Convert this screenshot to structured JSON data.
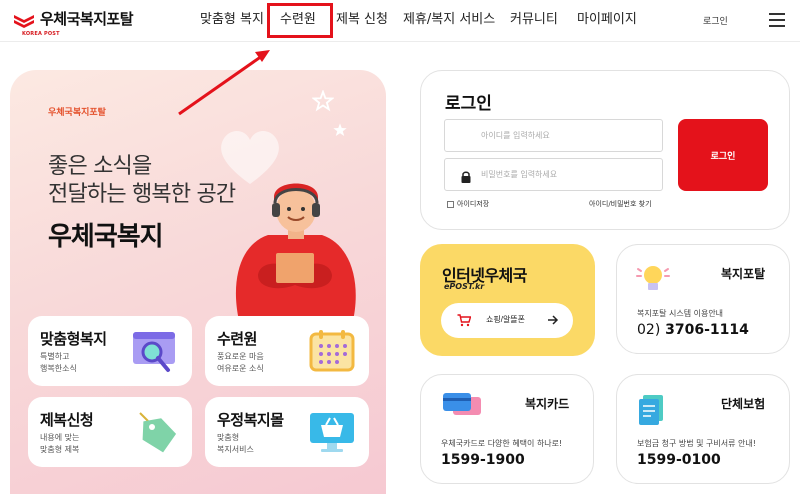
{
  "header": {
    "logo_title": "우체국복지포탈",
    "logo_sub": "KOREA POST",
    "nav": [
      "맞춤형 복지",
      "수련원",
      "제복 신청",
      "제휴/복지 서비스",
      "커뮤니티",
      "마이페이지"
    ],
    "login_link": "로그인"
  },
  "hero": {
    "tag": "우체국복지포탈",
    "line1": "좋은 소식을",
    "line2": "전달하는 행복한 공간",
    "strong": "우체국복지",
    "tiles": [
      {
        "title": "맞춤형복지",
        "desc1": "특별하고",
        "desc2": "행복한소식"
      },
      {
        "title": "수련원",
        "desc1": "풍요로운 마음",
        "desc2": "여유로운 소식"
      },
      {
        "title": "제복신청",
        "desc1": "내용에 맞는",
        "desc2": "맞춤형 제복"
      },
      {
        "title": "우정복지몰",
        "desc1": "맞춤형",
        "desc2": "복지서비스"
      }
    ]
  },
  "login": {
    "title": "로그인",
    "id_placeholder": "아이디를 입력하세요",
    "pw_placeholder": "비밀번호를 입력하세요",
    "button": "로그인",
    "remember": "아이디저장",
    "find": "아이디/비밀번호 찾기"
  },
  "epost": {
    "title": "인터넷우체국",
    "sub": "ePOST.kr",
    "button": "쇼핑/알뜰폰"
  },
  "cards": {
    "welfare_portal": {
      "title": "복지포탈",
      "desc": "복지포탈 시스템 이용안내",
      "phone_prefix": "02)",
      "phone": "3706-1114"
    },
    "welfare_card": {
      "title": "복지카드",
      "desc": "우체국카드로 다양한 혜택이 하나로!",
      "phone": "1599-1900"
    },
    "group_insurance": {
      "title": "단체보험",
      "desc": "보험금 청구 방법 및 구비서류 안내!",
      "phone": "1599-0100"
    }
  },
  "colors": {
    "brand_red": "#e4121b",
    "epost_yellow": "#fbd966",
    "hero_pink": "#f8d9d9"
  }
}
